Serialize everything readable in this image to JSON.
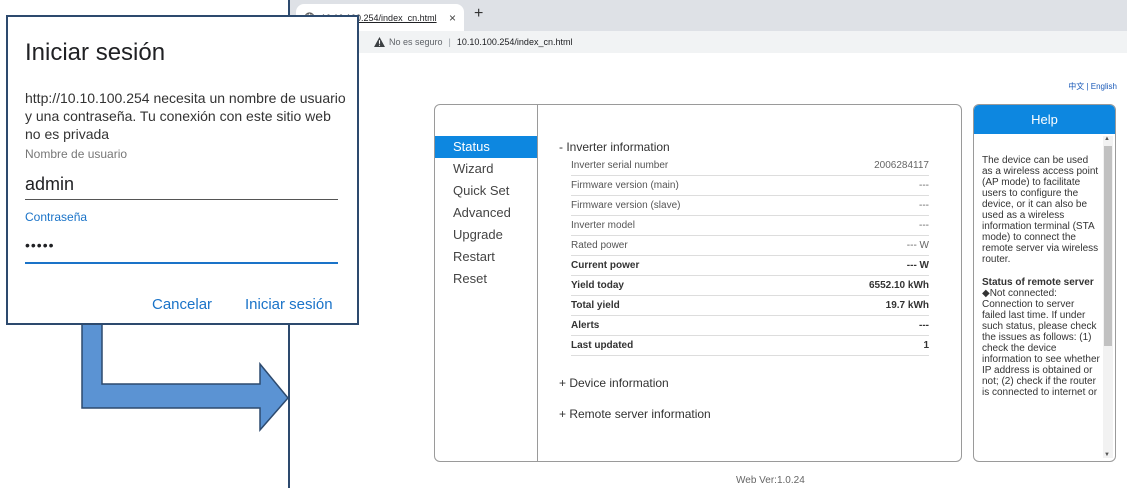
{
  "browser": {
    "tab_title": "10.10.100.254/index_cn.html",
    "tab_close": "×",
    "new_tab": "+",
    "not_secure": "No es seguro",
    "separator": "|",
    "url": "10.10.100.254/index_cn.html"
  },
  "language_links": "中文 | English",
  "nav": {
    "items": [
      {
        "label": "Status",
        "active": true
      },
      {
        "label": "Wizard"
      },
      {
        "label": "Quick Set"
      },
      {
        "label": "Advanced"
      },
      {
        "label": "Upgrade"
      },
      {
        "label": "Restart"
      },
      {
        "label": "Reset"
      }
    ]
  },
  "inverter": {
    "title": "-  Inverter information",
    "rows": [
      {
        "label": "Inverter serial number",
        "value": "2006284117"
      },
      {
        "label": "Firmware version (main)",
        "value": "---"
      },
      {
        "label": "Firmware version (slave)",
        "value": "---"
      },
      {
        "label": "Inverter model",
        "value": "---"
      },
      {
        "label": "Rated power",
        "value": "--- W"
      },
      {
        "label": "Current power",
        "value": "--- W"
      },
      {
        "label": "Yield today",
        "value": "6552.10 kWh"
      },
      {
        "label": "Total yield",
        "value": "19.7 kWh"
      },
      {
        "label": "Alerts",
        "value": "---"
      },
      {
        "label": "Last updated",
        "value": "1"
      }
    ]
  },
  "device_info": "+  Device information",
  "remote_info": "+  Remote server information",
  "web_version": "Web Ver:1.0.24",
  "help": {
    "title": "Help",
    "intro": "The device can be used as a wireless access point (AP mode) to facilitate users to configure the device, or it can also be used as a wireless information terminal (STA mode) to connect the remote server via wireless router.",
    "remote_heading": "Status of remote server",
    "remote_text": "◆Not connected: Connection to server failed last time. If under such status, please check the issues as follows: (1) check the device information to see whether IP address is obtained or not; (2) check if the router is connected to internet or"
  },
  "dialog": {
    "title": "Iniciar sesión",
    "message": "http://10.10.100.254 necesita un nombre de usuario y una contraseña. Tu conexión con este sitio web no es privada",
    "user_label": "Nombre de usuario",
    "user_value": "admin",
    "pass_label": "Contraseña",
    "pass_value": "•••••",
    "cancel": "Cancelar",
    "login": "Iniciar sesión"
  },
  "colors": {
    "accent_blue": "#0d87e0",
    "link_blue": "#1a73c8",
    "arrow_blue": "#5b93d3"
  }
}
